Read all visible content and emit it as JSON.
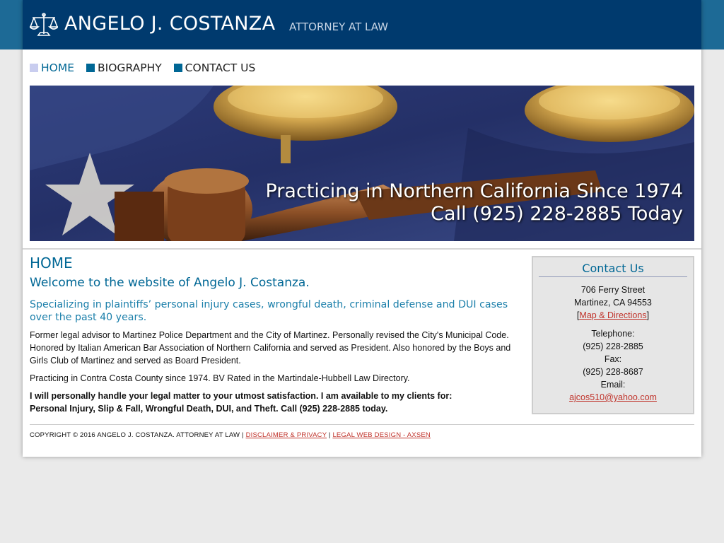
{
  "header": {
    "site_name": "ANGELO J. COSTANZA",
    "tagline": "ATTORNEY AT LAW",
    "logo_icon": "scales-of-justice-icon",
    "colors": {
      "header_bg": "#003a6e",
      "topbar_bg": "#1d6a96",
      "accent": "#006795",
      "link": "#c0332b"
    }
  },
  "nav": {
    "items": [
      {
        "label": "HOME",
        "active": true
      },
      {
        "label": "BIOGRAPHY",
        "active": false
      },
      {
        "label": "CONTACT US",
        "active": false
      }
    ]
  },
  "banner": {
    "line1": "Practicing in Northern California Since 1974",
    "line2": "Call (925) 228-2885 Today",
    "image": "gavel-and-scales-on-flag"
  },
  "main": {
    "heading": "HOME",
    "welcome": "Welcome to the website of Angelo J. Costanza.",
    "specializing": "Specializing in plaintiffs’ personal injury cases, wrongful death, criminal defense and DUI cases over the past 40 years.",
    "para1": "Former legal advisor to Martinez Police Department and the City of Martinez. Personally revised the City's Municipal Code. Honored by Italian American Bar Association of Northern California and served as President. Also honored by the Boys and Girls Club of Martinez and served as Board President.",
    "para2": "Practicing in Contra Costa County since 1974. BV Rated in the Martindale-Hubbell Law Directory.",
    "para3_line1": "I will personally handle your legal matter to your utmost satisfaction. I am available to my clients for:",
    "para3_line2": "Personal Injury, Slip & Fall, Wrongful Death, DUI, and Theft. Call (925) 228-2885 today."
  },
  "sidebar": {
    "title": "Contact Us",
    "street": "706 Ferry Street",
    "city": "Martinez, CA 94553",
    "map_link": "Map & Directions",
    "bracket_open": "[",
    "bracket_close": "]",
    "tel_label": "Telephone:",
    "tel": "(925) 228-2885",
    "fax_label": "Fax:",
    "fax": "(925) 228-8687",
    "email_label": "Email:",
    "email": "ajcos510@yahoo.com"
  },
  "footer": {
    "copyright": "COPYRIGHT © 2016 ANGELO J. COSTANZA. ATTORNEY AT LAW |",
    "disclaimer": "DISCLAIMER & PRIVACY",
    "sep": "|",
    "design": "LEGAL WEB DESIGN - AXSEN"
  }
}
